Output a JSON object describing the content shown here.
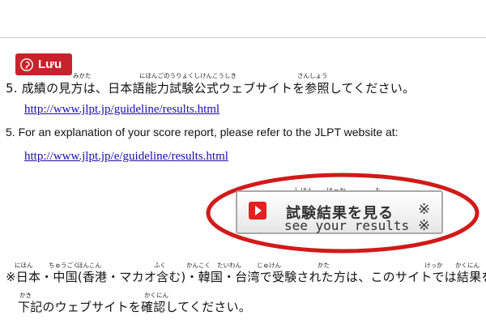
{
  "save_button": {
    "label": "Lưu",
    "icon": "pinterest-icon",
    "color": "#c8232c"
  },
  "item_ja": {
    "number": "5.",
    "text": "成績の見方は、日本語能力試験公式ウェブサイトを参照してください。",
    "furigana": {
      "mikata": "みかた",
      "nihongo_noryoku_shiken_koshiki": "にほんごのうりょくしけんこうしき",
      "sansho": "さんしょう"
    },
    "link": "http://www.jlpt.jp/guideline/results.html"
  },
  "item_en": {
    "number": "5.",
    "text": "For an explanation of your score report, please refer to the JLPT website at:",
    "link": "http://www.jlpt.jp/e/guideline/results.html"
  },
  "result_button": {
    "furigana": {
      "shiken": "しけん",
      "kekka": "けっか",
      "mi": "み"
    },
    "label_ja": "試験結果を見る",
    "label_en": "see your results",
    "mark": "※",
    "icon": "play-icon",
    "annotation": "red-ellipse"
  },
  "note": {
    "line1": "※日本・中国(香港・マカオ含む)・韓国・台湾で受験された方は、このサイトでは結果を確認",
    "line2": "下記のウェブサイトを確認してください。",
    "furigana": {
      "nihon": "にほん",
      "chugoku": "ちゅうごく",
      "honkon": "ほんこん",
      "fuku": "ふく",
      "kankoku": "かんこく",
      "taiwan": "たいわん",
      "juken": "じゅけん",
      "kata": "かた",
      "kekka": "けっか",
      "kakunin": "かくにん",
      "kaki": "かき",
      "kakunin2": "かくにん"
    }
  }
}
